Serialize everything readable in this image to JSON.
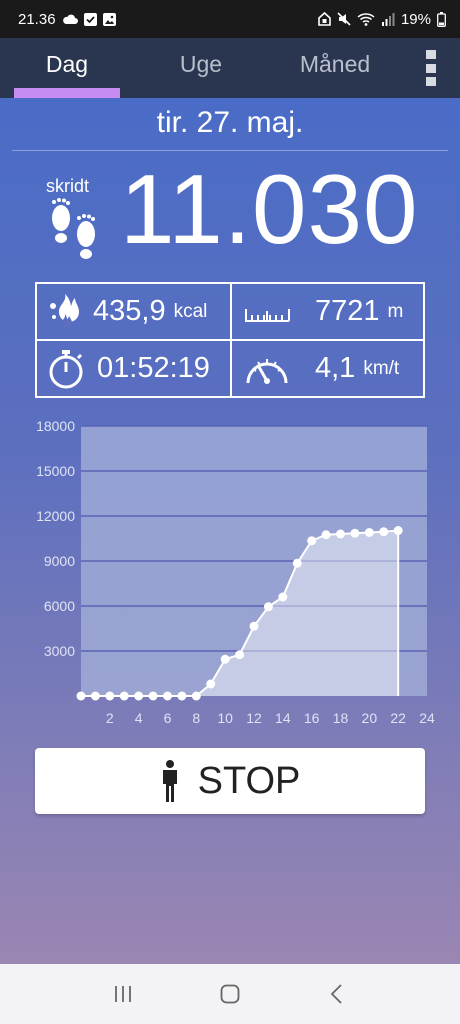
{
  "status_bar": {
    "time": "21.36",
    "battery": "19%"
  },
  "tabs": [
    {
      "label": "Dag",
      "active": true
    },
    {
      "label": "Uge",
      "active": false
    },
    {
      "label": "Måned",
      "active": false
    }
  ],
  "day": {
    "date": "tir. 27. maj.",
    "steps_label": "skridt",
    "steps_value": "11.030"
  },
  "stats": {
    "calories": {
      "value": "435,9",
      "unit": "kcal",
      "icon": "flame-icon"
    },
    "distance": {
      "value": "7721",
      "unit": "m",
      "icon": "ruler-icon"
    },
    "duration": {
      "value": "01:52:19",
      "icon": "stopwatch-icon"
    },
    "speed": {
      "value": "4,1",
      "unit": "km/t",
      "icon": "speedometer-icon"
    }
  },
  "chart_data": {
    "type": "area",
    "x": [
      0,
      1,
      2,
      3,
      4,
      5,
      6,
      7,
      8,
      9,
      10,
      11,
      12,
      13,
      14,
      15,
      16,
      17,
      18,
      19,
      20,
      21,
      22
    ],
    "values": [
      0,
      0,
      0,
      0,
      0,
      0,
      0,
      0,
      0,
      800,
      2450,
      2750,
      4650,
      5950,
      6600,
      8850,
      10350,
      10750,
      10800,
      10850,
      10900,
      10950,
      11030
    ],
    "xlim": [
      0,
      24
    ],
    "ylim": [
      0,
      18000
    ],
    "x_ticks": [
      "2",
      "4",
      "6",
      "8",
      "10",
      "12",
      "14",
      "16",
      "18",
      "20",
      "22",
      "24"
    ],
    "y_ticks": [
      "3000",
      "6000",
      "9000",
      "12000",
      "15000",
      "18000"
    ],
    "grid": true,
    "colors": {
      "plot_bg": "#a6b2d9",
      "grid": "#5b63b5",
      "line": "#ffffff",
      "ticks": "#dfe3f5"
    }
  },
  "stop_button": {
    "label": "STOP",
    "icon": "person-standing-icon"
  },
  "colors": {
    "tab_bar": "#2a3550",
    "tab_indicator": "#c78cf2",
    "gradient_top": "#4a6cc6",
    "gradient_bottom": "#9a86b3"
  }
}
